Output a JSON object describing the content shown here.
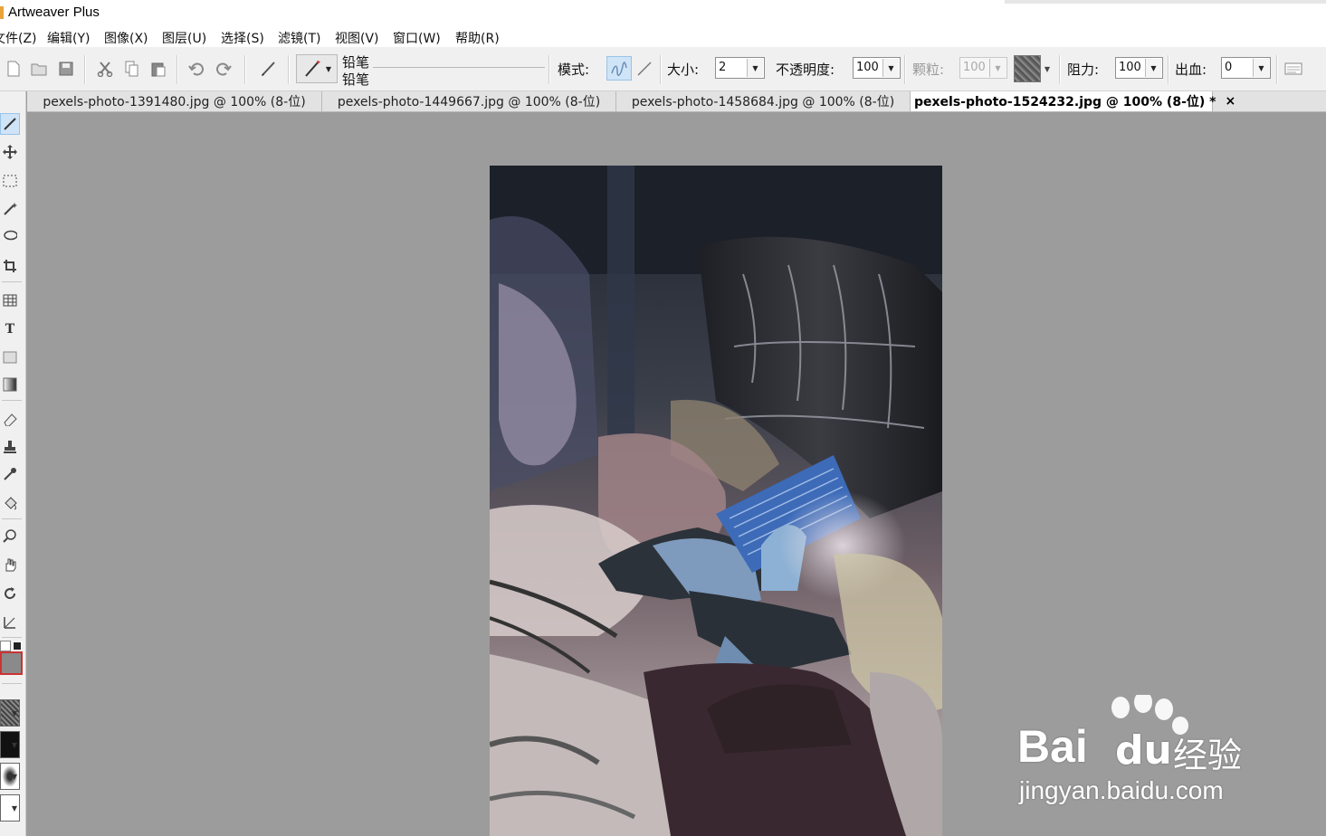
{
  "app": {
    "title": "Artweaver Plus"
  },
  "menu": [
    "文件(Z)",
    "编辑(Y)",
    "图像(X)",
    "图层(U)",
    "选择(S)",
    "滤镜(T)",
    "视图(V)",
    "窗口(W)",
    "帮助(R)"
  ],
  "toolbar": {
    "brush_category": "铅笔",
    "brush_variant": "铅笔",
    "mode_label": "模式:",
    "size_label": "大小:",
    "size_value": "2",
    "opacity_label": "不透明度:",
    "opacity_value": "100",
    "grain_label": "颗粒:",
    "grain_value": "100",
    "resistance_label": "阻力:",
    "resistance_value": "100",
    "bleed_label": "出血:",
    "bleed_value": "0"
  },
  "tabs": [
    {
      "label": "pexels-photo-1391480.jpg @ 100% (8-位)",
      "active": false
    },
    {
      "label": "pexels-photo-1449667.jpg @ 100% (8-位)",
      "active": false
    },
    {
      "label": "pexels-photo-1458684.jpg @ 100% (8-位)",
      "active": false
    },
    {
      "label": "pexels-photo-1524232.jpg @ 100% (8-位) *",
      "active": true
    }
  ],
  "tab_close": "×",
  "watermark": {
    "brand": "Bai",
    "brand_cn": "经验",
    "url": "jingyan.baidu.com"
  },
  "colors": {
    "canvas_bg": "#9c9c9c",
    "active_tool": "#cfe4f7"
  }
}
